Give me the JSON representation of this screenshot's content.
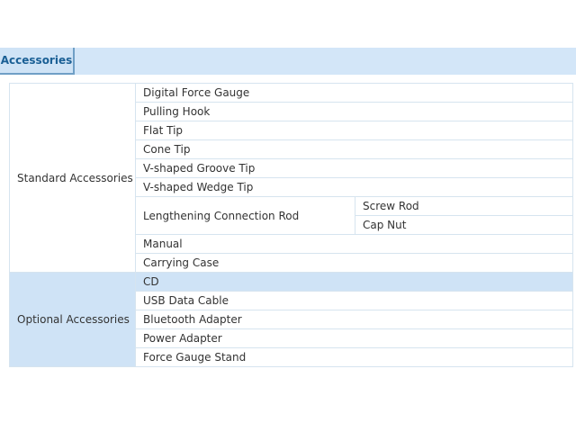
{
  "tab": {
    "label": "Accessories"
  },
  "standard": {
    "label": "Standard Accessories",
    "items": [
      "Digital Force Gauge",
      "Pulling Hook",
      "Flat Tip",
      "Cone Tip",
      "V-shaped Groove Tip",
      "V-shaped Wedge Tip"
    ],
    "rod": {
      "label": "Lengthening Connection Rod",
      "parts": [
        "Screw Rod",
        "Cap Nut"
      ]
    },
    "items_after": [
      "Manual",
      "Carrying Case"
    ]
  },
  "optional": {
    "label": "Optional Accessories",
    "items": [
      "CD",
      "USB Data Cable",
      "Bluetooth Adapter",
      "Power Adapter",
      "Force Gauge Stand"
    ]
  },
  "colors": {
    "tab_bar": "#d3e6f8",
    "tab_border": "#6f9fc6",
    "tab_text": "#1a5f95",
    "highlight": "#cfe3f6",
    "grid": "#d6e4ef"
  }
}
